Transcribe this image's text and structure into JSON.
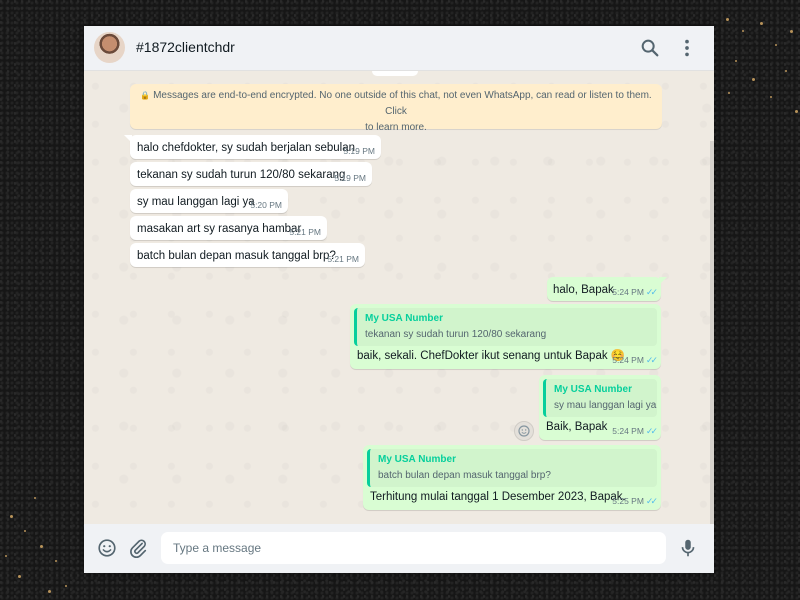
{
  "header": {
    "title": "#1872clientchdr"
  },
  "encryption_notice": "Messages are end-to-end encrypted. No one outside of this chat, not even WhatsApp, can read or listen to them. Click to learn more.",
  "encryption_line1": "Messages are end-to-end encrypted. No one outside of this chat, not even WhatsApp, can read or listen to them. Click",
  "encryption_line2": "to learn more.",
  "incoming": [
    {
      "text": "halo chefdokter, sy sudah berjalan sebulan",
      "time": "5:19 PM"
    },
    {
      "text": "tekanan sy sudah turun 120/80 sekarang",
      "time": "5:19 PM"
    },
    {
      "text": "sy mau langgan lagi ya",
      "time": "5:20 PM"
    },
    {
      "text": "masakan art sy rasanya hambar",
      "time": "5:21 PM"
    },
    {
      "text": "batch bulan depan masuk tanggal brp?",
      "time": "5:21 PM"
    }
  ],
  "outgoing": [
    {
      "text": "halo, Bapak",
      "time": "5:24 PM"
    },
    {
      "quote_name": "My USA Number",
      "quote_text": "tekanan sy sudah turun 120/80 sekarang",
      "text": "baik, sekali. ChefDokter ikut senang untuk Bapak ☺️",
      "time": "5:24 PM"
    },
    {
      "quote_name": "My USA Number",
      "quote_text": "sy mau langgan lagi ya",
      "text": "Baik, Bapak",
      "time": "5:24 PM"
    },
    {
      "quote_name": "My USA Number",
      "quote_text": "batch bulan depan masuk tanggal brp?",
      "text": "Terhitung mulai tanggal 1 Desember 2023, Bapak.",
      "time": "5:25 PM"
    }
  ],
  "footer": {
    "placeholder": "Type a message"
  },
  "colors": {
    "outgoing_bubble": "#d9fdd3",
    "incoming_bubble": "#ffffff",
    "quote_accent": "#06cf9c",
    "read_ticks": "#53bdeb",
    "notice_bg": "#ffeecd"
  },
  "icons": [
    "search-icon",
    "more-vertical-icon",
    "lock-icon",
    "emoji-icon",
    "attach-icon",
    "mic-icon",
    "double-check-icon",
    "react-emoji-icon"
  ]
}
